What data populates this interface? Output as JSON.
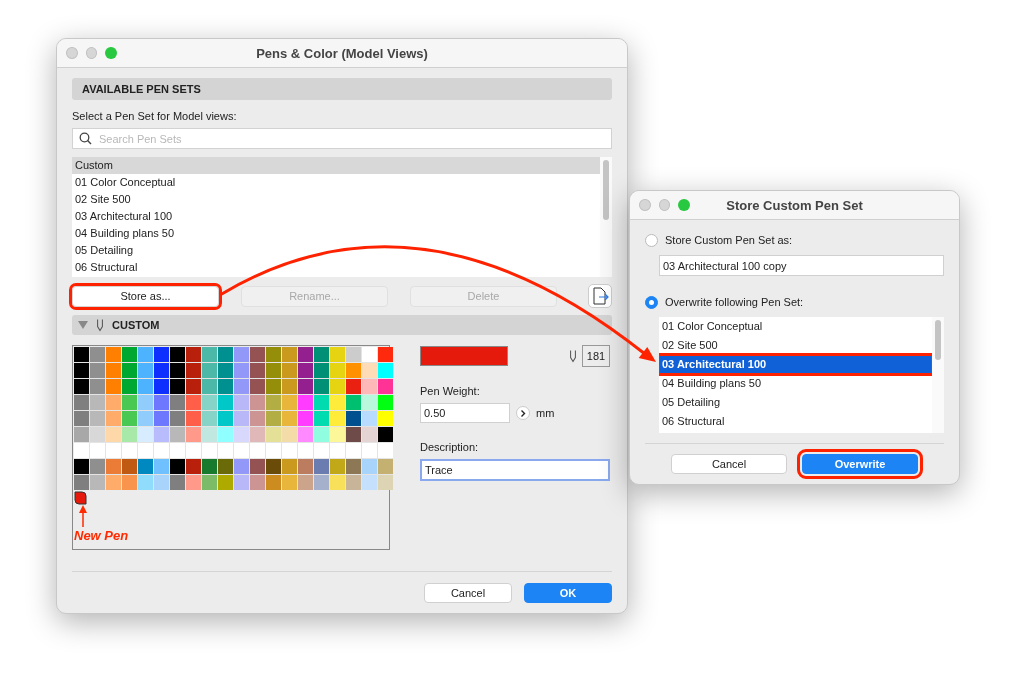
{
  "main_window": {
    "title": "Pens & Color (Model Views)",
    "section_header": "AVAILABLE PEN SETS",
    "prompt": "Select a Pen Set for Model views:",
    "search": {
      "placeholder": "Search Pen Sets"
    },
    "pen_sets": [
      {
        "label": "Custom",
        "selected": true
      },
      {
        "label": "01 Color Conceptual",
        "selected": false
      },
      {
        "label": "02 Site 500",
        "selected": false
      },
      {
        "label": "03 Architectural 100",
        "selected": false
      },
      {
        "label": "04 Building plans 50",
        "selected": false
      },
      {
        "label": "05 Detailing",
        "selected": false
      },
      {
        "label": "06 Structural",
        "selected": false
      }
    ],
    "buttons": [
      {
        "label": "Store as...",
        "disabled": false,
        "highlighted": true
      },
      {
        "label": "Rename...",
        "disabled": true,
        "highlighted": false
      },
      {
        "label": "Delete",
        "disabled": true,
        "highlighted": false
      }
    ],
    "custom_section": {
      "title": "CUSTOM",
      "expanded": true
    },
    "palette": [
      {
        "swatches": [
          {
            "color": "#000000"
          },
          {
            "color": "#8f8f8f"
          },
          {
            "color": "#ff7f00"
          },
          {
            "color": "#00a832"
          },
          {
            "color": "#4db3ff"
          },
          {
            "color": "#0f2fff"
          },
          {
            "color": "#000000"
          },
          {
            "color": "#b8200c"
          },
          {
            "color": "#4bb8a8"
          },
          {
            "color": "#009090"
          },
          {
            "color": "#9198f8"
          },
          {
            "color": "#955252"
          },
          {
            "color": "#948e0a"
          },
          {
            "color": "#ca9a1e"
          },
          {
            "color": "#941f8f"
          },
          {
            "color": "#009076"
          },
          {
            "color": "#e6d412"
          },
          {
            "color": "#cccccc"
          },
          {
            "color": "#ffffff"
          },
          {
            "color": "#ff2a0d"
          }
        ]
      },
      {
        "swatches": [
          {
            "color": "#000000"
          },
          {
            "color": "#8f8f8f"
          },
          {
            "color": "#ff7f00"
          },
          {
            "color": "#00a832"
          },
          {
            "color": "#4db3ff"
          },
          {
            "color": "#0f2fff"
          },
          {
            "color": "#000000"
          },
          {
            "color": "#b8200c"
          },
          {
            "color": "#4bb8a8"
          },
          {
            "color": "#009090"
          },
          {
            "color": "#9198f8"
          },
          {
            "color": "#955252"
          },
          {
            "color": "#948e0a"
          },
          {
            "color": "#ca9a1e"
          },
          {
            "color": "#941f8f"
          },
          {
            "color": "#009076"
          },
          {
            "color": "#e6d412"
          },
          {
            "color": "#ff9000"
          },
          {
            "color": "#ffdcb8"
          },
          {
            "color": "#00ffff"
          }
        ]
      },
      {
        "swatches": [
          {
            "color": "#000000"
          },
          {
            "color": "#8f8f8f"
          },
          {
            "color": "#ff7f00"
          },
          {
            "color": "#00a832"
          },
          {
            "color": "#4db3ff"
          },
          {
            "color": "#0f2fff"
          },
          {
            "color": "#000000"
          },
          {
            "color": "#b8200c"
          },
          {
            "color": "#4bb8a8"
          },
          {
            "color": "#009090"
          },
          {
            "color": "#9198f8"
          },
          {
            "color": "#955252"
          },
          {
            "color": "#948e0a"
          },
          {
            "color": "#ca9a1e"
          },
          {
            "color": "#941f8f"
          },
          {
            "color": "#009076"
          },
          {
            "color": "#e6d412"
          },
          {
            "color": "#ea2010"
          },
          {
            "color": "#ffb8b8"
          },
          {
            "color": "#ff3296"
          }
        ]
      },
      {
        "swatches": [
          {
            "color": "#7f7f7f"
          },
          {
            "color": "#b8b8b8"
          },
          {
            "color": "#ffab6a"
          },
          {
            "color": "#4ac854"
          },
          {
            "color": "#90ccfc"
          },
          {
            "color": "#6e78ff"
          },
          {
            "color": "#7f7f7f"
          },
          {
            "color": "#ff5e48"
          },
          {
            "color": "#86d4c8"
          },
          {
            "color": "#00c8c8"
          },
          {
            "color": "#b8b8f8"
          },
          {
            "color": "#cd9494"
          },
          {
            "color": "#b2ae44"
          },
          {
            "color": "#e8b63a"
          },
          {
            "color": "#ff3cff"
          },
          {
            "color": "#00dcb0"
          },
          {
            "color": "#ffec3a"
          },
          {
            "color": "#00c070"
          },
          {
            "color": "#b8f8dc"
          },
          {
            "color": "#00ff10"
          }
        ]
      },
      {
        "swatches": [
          {
            "color": "#7f7f7f"
          },
          {
            "color": "#b8b8b8"
          },
          {
            "color": "#ffab6a"
          },
          {
            "color": "#4ac854"
          },
          {
            "color": "#90ccfc"
          },
          {
            "color": "#6e78ff"
          },
          {
            "color": "#7f7f7f"
          },
          {
            "color": "#ff5e48"
          },
          {
            "color": "#86d4c8"
          },
          {
            "color": "#00c8c8"
          },
          {
            "color": "#b8b8f8"
          },
          {
            "color": "#cd9494"
          },
          {
            "color": "#b2ae44"
          },
          {
            "color": "#e8b63a"
          },
          {
            "color": "#ff3cff"
          },
          {
            "color": "#00dcb0"
          },
          {
            "color": "#ffec3a"
          },
          {
            "color": "#005090"
          },
          {
            "color": "#b8dcff"
          },
          {
            "color": "#ffff00"
          }
        ]
      },
      {
        "swatches": [
          {
            "color": "#a8a8a8"
          },
          {
            "color": "#d8d8d8"
          },
          {
            "color": "#ffd8aa"
          },
          {
            "color": "#a8e8a8"
          },
          {
            "color": "#d8ecff"
          },
          {
            "color": "#b8bcfc"
          },
          {
            "color": "#b8b8b8"
          },
          {
            "color": "#ff9a8a"
          },
          {
            "color": "#c0e8e0"
          },
          {
            "color": "#90ffff"
          },
          {
            "color": "#d8d8fc"
          },
          {
            "color": "#e0b8b8"
          },
          {
            "color": "#e4e098"
          },
          {
            "color": "#f4dca8"
          },
          {
            "color": "#ff8aff"
          },
          {
            "color": "#90fce0"
          },
          {
            "color": "#fcf89a"
          },
          {
            "color": "#6e4a48"
          },
          {
            "color": "#e4d4d4"
          },
          {
            "color": "#000000"
          }
        ]
      },
      {
        "swatches": [
          {
            "color": "#ffffff"
          },
          {
            "color": "#ffffff"
          },
          {
            "color": "#ffffff"
          },
          {
            "color": "#ffffff"
          },
          {
            "color": "#ffffff"
          },
          {
            "color": "#ffffff"
          },
          {
            "color": "#ffffff"
          },
          {
            "color": "#ffffff"
          },
          {
            "color": "#ffffff"
          },
          {
            "color": "#ffffff"
          },
          {
            "color": "#ffffff"
          },
          {
            "color": "#ffffff"
          },
          {
            "color": "#ffffff"
          },
          {
            "color": "#ffffff"
          },
          {
            "color": "#ffffff"
          },
          {
            "color": "#ffffff"
          },
          {
            "color": "#ffffff"
          },
          {
            "color": "#ffffff"
          },
          {
            "color": "#ffffff"
          },
          {
            "color": "#ffffff"
          }
        ]
      },
      {
        "swatches": [
          {
            "color": "#000000"
          },
          {
            "color": "#8f8f8f"
          },
          {
            "color": "#eb7c38"
          },
          {
            "color": "#c05a12"
          },
          {
            "color": "#0088c0"
          },
          {
            "color": "#6ec0ff"
          },
          {
            "color": "#000000"
          },
          {
            "color": "#b8200c"
          },
          {
            "color": "#187a2c"
          },
          {
            "color": "#6a6a08"
          },
          {
            "color": "#9198f8"
          },
          {
            "color": "#955252"
          },
          {
            "color": "#6a4c08"
          },
          {
            "color": "#ca9a1e"
          },
          {
            "color": "#bc7c60"
          },
          {
            "color": "#6a7cb0"
          },
          {
            "color": "#c0a818"
          },
          {
            "color": "#8c7854"
          },
          {
            "color": "#a8d4fc"
          },
          {
            "color": "#c4b070"
          }
        ]
      },
      {
        "swatches": [
          {
            "color": "#7f7f7f"
          },
          {
            "color": "#b8b8b8"
          },
          {
            "color": "#ffab6a"
          },
          {
            "color": "#f8944c"
          },
          {
            "color": "#90dcfc"
          },
          {
            "color": "#a8d4fc"
          },
          {
            "color": "#7f7f7f"
          },
          {
            "color": "#ff9a8a"
          },
          {
            "color": "#7cbc68"
          },
          {
            "color": "#aeaa00"
          },
          {
            "color": "#b8b8f8"
          },
          {
            "color": "#cd9494"
          },
          {
            "color": "#cc8c20"
          },
          {
            "color": "#e8b63a"
          },
          {
            "color": "#cca48c"
          },
          {
            "color": "#a4b0cc"
          },
          {
            "color": "#f8e05a"
          },
          {
            "color": "#c8b498"
          },
          {
            "color": "#c4e0fc"
          },
          {
            "color": "#ddd4b4"
          }
        ]
      }
    ],
    "new_pen": {
      "label": "New Pen",
      "color": "#e51a0c"
    },
    "pen_number": "181",
    "pen_weight_label": "Pen Weight:",
    "pen_weight": "0.50",
    "unit": "mm",
    "description_label": "Description:",
    "description": "Trace",
    "footer_buttons": [
      {
        "label": "Cancel",
        "default": false
      },
      {
        "label": "OK",
        "default": true
      }
    ]
  },
  "store_dialog": {
    "title": "Store Custom Pen Set",
    "options": [
      {
        "kind": "new_name",
        "label": "Store Custom Pen Set as:",
        "selected": false,
        "value": "03 Architectural 100 copy"
      },
      {
        "kind": "overwrite",
        "label": "Overwrite following Pen Set:",
        "selected": true,
        "pen_sets": [
          {
            "label": "01 Color Conceptual",
            "selected": false,
            "highlighted": false
          },
          {
            "label": "02 Site 500",
            "selected": false,
            "highlighted": false
          },
          {
            "label": "03 Architectural 100",
            "selected": true,
            "highlighted": true
          },
          {
            "label": "04 Building plans 50",
            "selected": false,
            "highlighted": false
          },
          {
            "label": "05 Detailing",
            "selected": false,
            "highlighted": false
          },
          {
            "label": "06 Structural",
            "selected": false,
            "highlighted": false
          }
        ]
      }
    ],
    "buttons": [
      {
        "label": "Cancel",
        "default": false,
        "highlighted": false
      },
      {
        "label": "Overwrite",
        "default": true,
        "highlighted": true
      }
    ]
  }
}
